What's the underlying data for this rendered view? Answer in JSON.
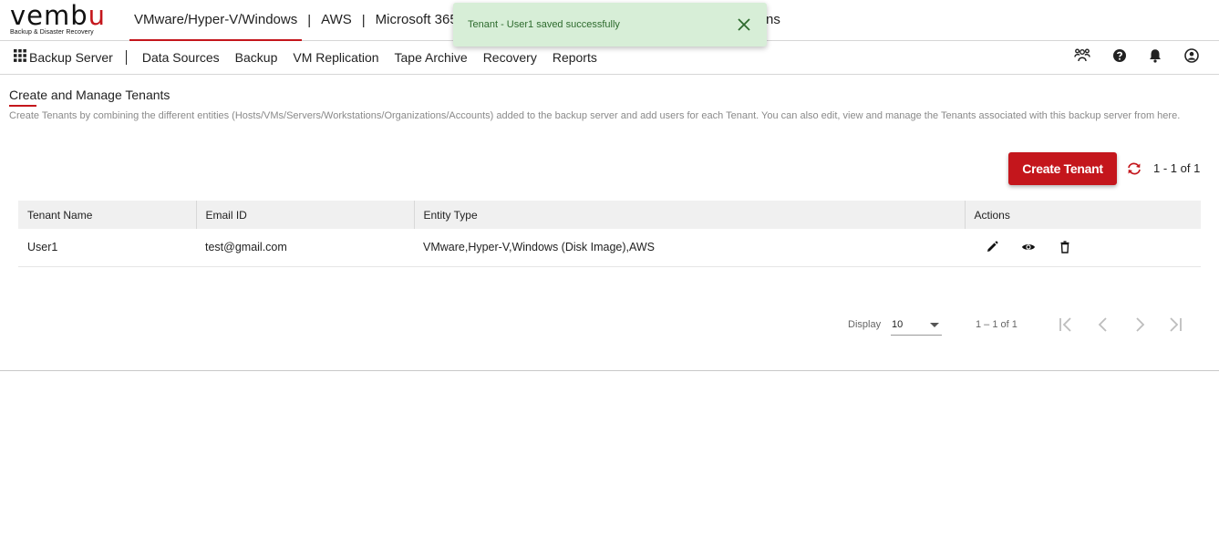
{
  "brand": {
    "name_start": "vemb",
    "name_accent": "u",
    "tagline": "Backup & Disaster Recovery"
  },
  "products": [
    {
      "label": "VMware/Hyper-V/Windows",
      "active": true
    },
    {
      "label": "AWS",
      "active": false
    },
    {
      "label": "Microsoft 365/G",
      "active": false
    }
  ],
  "products_partial": "ns",
  "toast": {
    "message": "Tenant - User1 saved successfully"
  },
  "subnav": {
    "server_label": "Backup Server",
    "items": [
      "Data Sources",
      "Backup",
      "VM Replication",
      "Tape Archive",
      "Recovery",
      "Reports"
    ]
  },
  "page": {
    "title": "Create and Manage Tenants",
    "description": "Create Tenants by combining the different entities (Hosts/VMs/Servers/Workstations/Organizations/Accounts) added to the backup server and add users for each Tenant. You can also edit, view and manage the Tenants associated with this backup server from here.",
    "create_button": "Create Tenant",
    "range_label": "1 - 1 of 1"
  },
  "table": {
    "columns": [
      "Tenant Name",
      "Email ID",
      "Entity Type",
      "Actions"
    ],
    "rows": [
      {
        "tenant_name": "User1",
        "email": "test@gmail.com",
        "entity_type": "VMware,Hyper-V,Windows (Disk Image),AWS"
      }
    ]
  },
  "pagination": {
    "display_label": "Display",
    "page_size": "10",
    "range": "1 – 1 of 1"
  },
  "colors": {
    "accent": "#c4161c",
    "toast_bg": "#d7eed7",
    "toast_text": "#2e6b2e"
  }
}
